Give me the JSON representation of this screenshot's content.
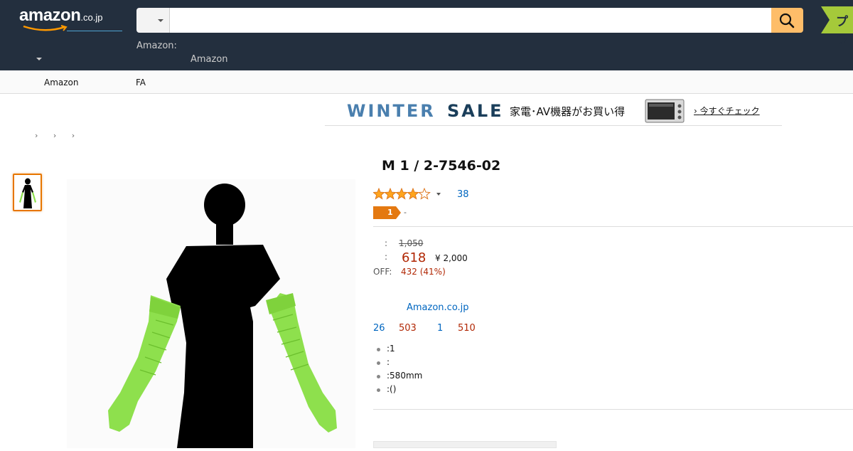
{
  "header": {
    "logo_text": "amazon",
    "logo_tld": ".co.jp",
    "search_placeholder": "",
    "search_value": "",
    "prime_text": "プラ",
    "sub_line1": "Amazon:",
    "sub_line2": "Amazon"
  },
  "subnav": {
    "items": [
      "Amazon",
      "FA"
    ]
  },
  "banner": {
    "winter": "WINTER",
    "sale": "SALE",
    "jp_text": "家電･AV機器がお買い得",
    "cta": "今すぐチェック"
  },
  "breadcrumb": "› › ›",
  "product": {
    "title": "M 1 / 2-7546-02",
    "rating_count": "38",
    "rating_value": 4,
    "rating_max": 5,
    "bestseller_rank": "1",
    "bestseller_suffix": "-",
    "list_price_colon": ":",
    "list_price": "1,050",
    "price_colon": ":",
    "price": "618",
    "reference_price": "¥ 2,000",
    "off_label": "OFF:",
    "off_value": "432 (41%)",
    "seller": "Amazon.co.jp",
    "stock": [
      "26",
      "503",
      "1",
      "510"
    ],
    "bullets": [
      ":1",
      ":",
      ":580mm",
      ":()"
    ]
  },
  "colors": {
    "header_bg": "#232f3e",
    "search_button": "#febd69",
    "price_red": "#b12704",
    "link_blue": "#0066c0",
    "badge_orange": "#e47911",
    "glove_green": "#8ee04d"
  },
  "icons": {
    "search": "search-icon",
    "dropdown": "chevron-down-icon",
    "star": "star-icon"
  }
}
